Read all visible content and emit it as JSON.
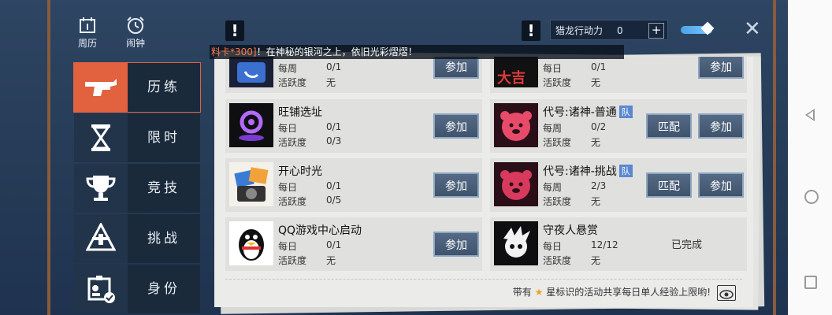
{
  "top_icons": {
    "calendar_label": "周历",
    "alarm_label": "闹钟"
  },
  "alert": {
    "glyph": "!"
  },
  "stamina": {
    "label": "猎龙行动力",
    "value": "0",
    "plus": "+"
  },
  "close_glyph": "✕",
  "ticker": {
    "highlight": "料卡*300]",
    "text": "！在神秘的银河之上，依旧光彩熠熠！"
  },
  "sidebar": {
    "items": [
      {
        "label": "历练",
        "icon": "gun-icon",
        "active": true
      },
      {
        "label": "限时",
        "icon": "hourglass-icon"
      },
      {
        "label": "竞技",
        "icon": "trophy-icon"
      },
      {
        "label": "挑战",
        "icon": "challenge-icon"
      },
      {
        "label": "身份",
        "icon": "id-badge-icon"
      }
    ]
  },
  "cards": {
    "c0": {
      "title": "",
      "r1": "每周",
      "v1": "0/1",
      "r2": "活跃度",
      "v2": "无",
      "join": "参加"
    },
    "c1": {
      "title": "",
      "r1": "每日",
      "v1": "0/1",
      "r2": "活跃度",
      "v2": "无",
      "join": "参加",
      "pic_text": "大吉"
    },
    "c2": {
      "title": "旺铺选址",
      "r1": "每日",
      "v1": "0/1",
      "r2": "活跃度",
      "v2": "0/3",
      "join": "参加"
    },
    "c3": {
      "title": "代号:诸神-普通",
      "badge": "队",
      "r1": "每周",
      "v1": "0/2",
      "r2": "活跃度",
      "v2": "无",
      "match": "匹配",
      "join": "参加"
    },
    "c4": {
      "title": "开心时光",
      "r1": "每日",
      "v1": "0/1",
      "r2": "活跃度",
      "v2": "0/5",
      "join": "参加"
    },
    "c5": {
      "title": "代号:诸神-挑战",
      "badge": "队",
      "r1": "每周",
      "v1": "2/3",
      "r2": "活跃度",
      "v2": "无",
      "match": "匹配",
      "join": "参加"
    },
    "c6": {
      "title": "QQ游戏中心启动",
      "r1": "每日",
      "v1": "0/1",
      "r2": "活跃度",
      "v2": "无",
      "join": "参加"
    },
    "c7": {
      "title": "守夜人悬赏",
      "r1": "每日",
      "v1": "12/12",
      "r2": "活跃度",
      "v2": "无",
      "status": "已完成"
    }
  },
  "footer": {
    "prefix": "带有",
    "star": "★",
    "text": "星标识的活动共享每日单人经验上限哟!"
  },
  "colors": {
    "active_tab": "#e2613f",
    "button": "#4a5f7a",
    "badge": "#5b88d0"
  }
}
